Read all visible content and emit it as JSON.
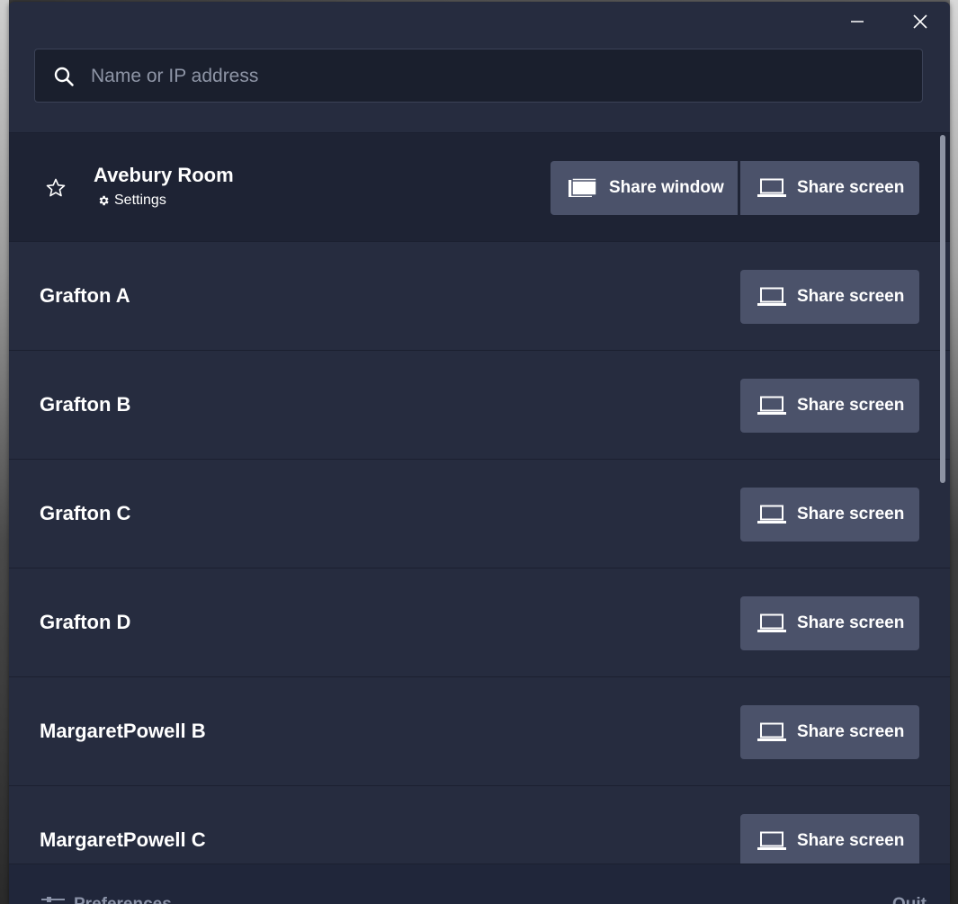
{
  "search": {
    "placeholder": "Name or IP address",
    "value": ""
  },
  "rooms": [
    {
      "name": "Avebury Room",
      "settings_label": "Settings",
      "share_window_label": "Share window",
      "share_screen_label": "Share screen"
    },
    {
      "name": "Grafton A",
      "share_screen_label": "Share screen"
    },
    {
      "name": "Grafton B",
      "share_screen_label": "Share screen"
    },
    {
      "name": "Grafton C",
      "share_screen_label": "Share screen"
    },
    {
      "name": "Grafton D",
      "share_screen_label": "Share screen"
    },
    {
      "name": "MargaretPowell B",
      "share_screen_label": "Share screen"
    },
    {
      "name": "MargaretPowell C",
      "share_screen_label": "Share screen"
    }
  ],
  "footer": {
    "preferences_label": "Preferences",
    "quit_label": "Quit"
  },
  "icons": {
    "minimize": "minimize-icon",
    "close": "close-icon",
    "search": "search-icon",
    "star": "star-icon",
    "gear": "gear-icon",
    "window": "window-icon",
    "laptop": "laptop-icon",
    "preferences": "sliders-icon"
  },
  "colors": {
    "window_bg": "#262c3f",
    "selected_row_bg": "#1e2334",
    "button_bg": "#4b526a",
    "search_bg": "#1a1f2d",
    "text": "#ffffff",
    "muted_text": "#8b93a8"
  }
}
